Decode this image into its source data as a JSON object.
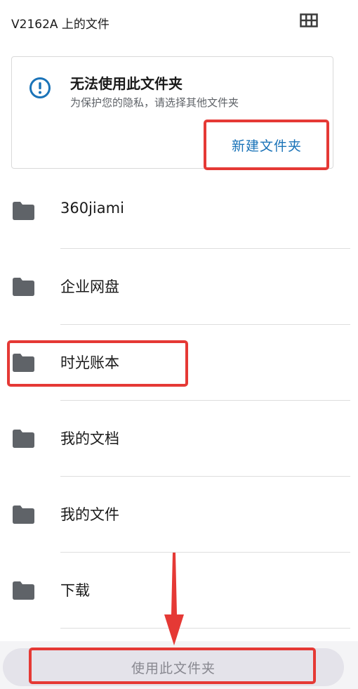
{
  "header": {
    "title": "V2162A 上的文件",
    "grid_icon": "grid-view-icon"
  },
  "notice": {
    "title": "无法使用此文件夹",
    "subtitle": "为保护您的隐私，请选择其他文件夹",
    "new_folder_label": "新建文件夹",
    "info_icon": "info-icon"
  },
  "folders": [
    {
      "label": "360jiami"
    },
    {
      "label": "企业网盘"
    },
    {
      "label": "时光账本"
    },
    {
      "label": "我的文档"
    },
    {
      "label": "我的文件"
    },
    {
      "label": "下载"
    }
  ],
  "footer": {
    "use_folder_label": "使用此文件夹"
  },
  "colors": {
    "accent": "#1a73b8",
    "highlight": "#e53935",
    "folder_icon": "#5f6368"
  }
}
